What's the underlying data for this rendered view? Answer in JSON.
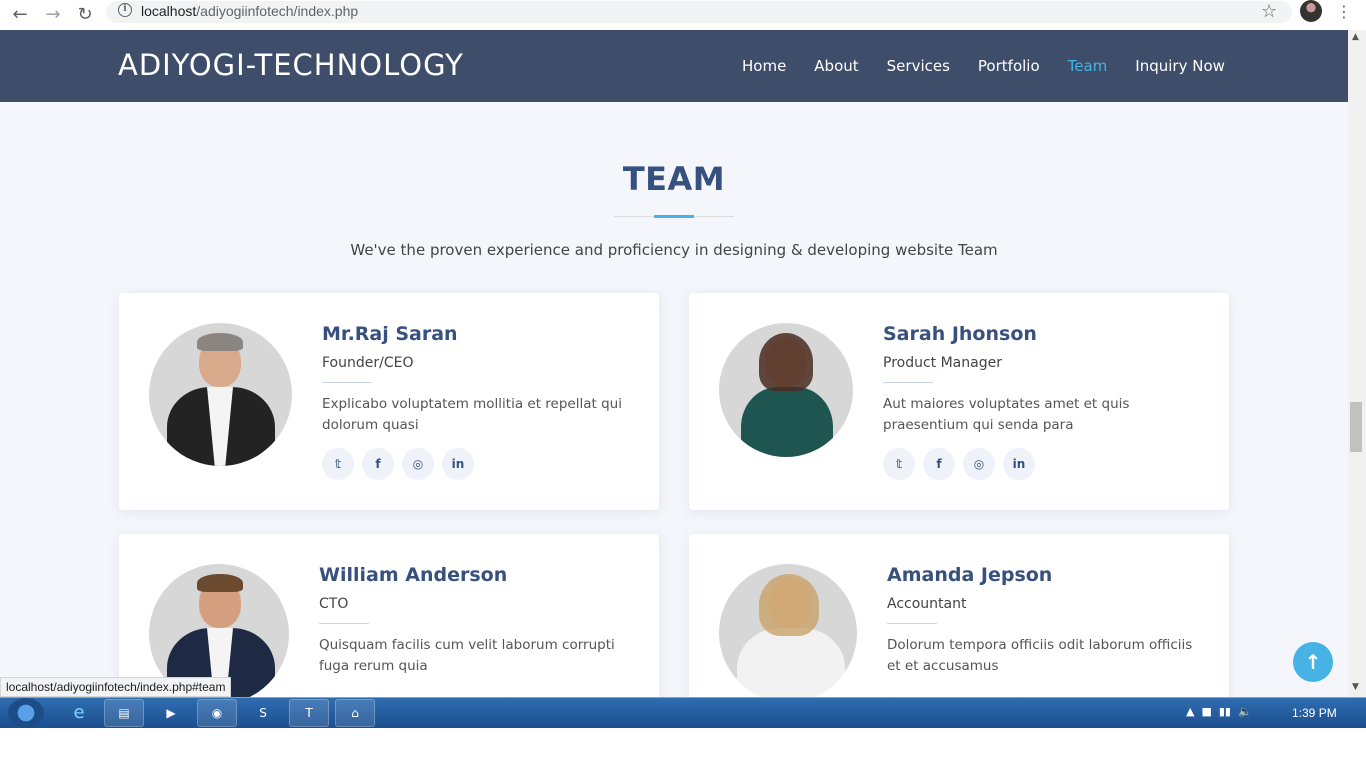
{
  "browser": {
    "url_host": "localhost",
    "url_path": "/adiyogiinfotech/index.php",
    "back_icon": "←",
    "forward_icon": "→",
    "reload_icon": "↻",
    "info_icon": "i",
    "star_icon": "☆",
    "menu_icon": "⋮"
  },
  "header": {
    "logo": "ADIYOGI-TECHNOLOGY",
    "nav": [
      "Home",
      "About",
      "Services",
      "Portfolio",
      "Team",
      "Inquiry Now"
    ],
    "active_item": "Team"
  },
  "team": {
    "title": "TEAM",
    "subtitle": "We've the proven experience and proficiency in designing & developing website Team",
    "members": [
      {
        "name": "Mr.Raj Saran",
        "role": "Founder/CEO",
        "desc": "Explicabo voluptatem mollitia et repellat qui dolorum quasi"
      },
      {
        "name": "Sarah Jhonson",
        "role": "Product Manager",
        "desc": "Aut maiores voluptates amet et quis praesentium qui senda para"
      },
      {
        "name": "William Anderson",
        "role": "CTO",
        "desc": "Quisquam facilis cum velit laborum corrupti fuga rerum quia"
      },
      {
        "name": "Amanda Jepson",
        "role": "Accountant",
        "desc": "Dolorum tempora officiis odit laborum officiis et et accusamus"
      }
    ],
    "social_icons": [
      "twitter-icon",
      "facebook-icon",
      "instagram-icon",
      "linkedin-icon"
    ]
  },
  "back_to_top_icon": "↑",
  "status_url": "localhost/adiyogiinfotech/index.php#team",
  "taskbar": {
    "clock": "1:39 PM"
  },
  "colors": {
    "header_bg": "#3d4d6a",
    "accent": "#47b2e4",
    "heading": "#37517e",
    "page_bg": "#f5f6fb"
  }
}
